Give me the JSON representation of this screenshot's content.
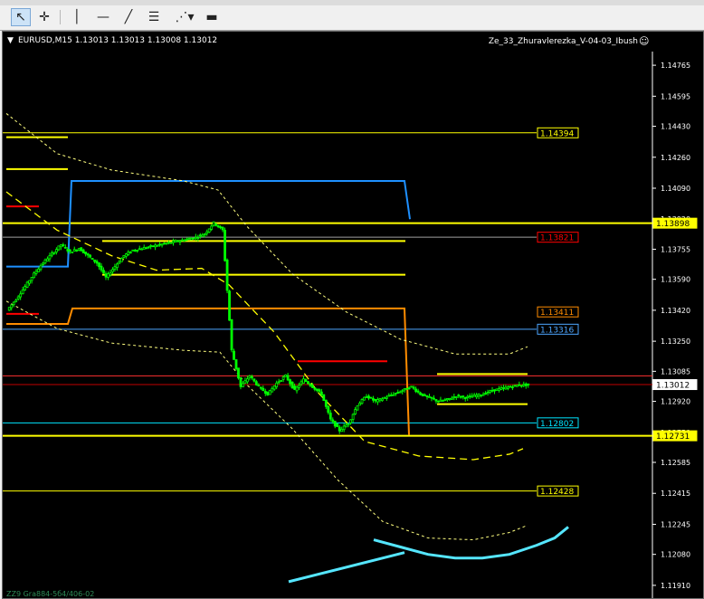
{
  "toolbar": {
    "items": [
      {
        "name": "cursor-tool-icon",
        "glyph": "↖"
      },
      {
        "name": "crosshair-tool-icon",
        "glyph": "✛"
      },
      {
        "name": "vertical-line-tool-icon",
        "glyph": "│"
      },
      {
        "name": "horizontal-line-tool-icon",
        "glyph": "—"
      },
      {
        "name": "trendline-tool-icon",
        "glyph": "╱"
      },
      {
        "name": "fibonacci-tool-icon",
        "glyph": "☰"
      },
      {
        "name": "shapes-tool-icon",
        "glyph": "⋰▾"
      },
      {
        "name": "label-tool-icon",
        "glyph": "▬"
      }
    ]
  },
  "chart": {
    "symbol_info": "EURUSD,M15  1.13013 1.13013 1.13008 1.13012",
    "indicator_name": "Ze_33_Zhuravlerezka_V-04-03_Ibush",
    "smiley_icon": "☺",
    "footer_text": "ZZ9 Gra884-5б4/406-02",
    "colors": {
      "bg": "#000000",
      "axis": "#ffffff",
      "candle": "#00ff00",
      "yellow": "#ffff00",
      "blue": "#1e90ff",
      "orange": "#ff8c00",
      "red": "#ff0000",
      "cyan": "#00e5ff"
    }
  },
  "chart_data": {
    "type": "candlestick",
    "symbol": "EURUSD",
    "timeframe": "M15",
    "ylim": [
      1.1184,
      1.1484
    ],
    "y_ticks": [
      "1.14765",
      "1.14595",
      "1.14430",
      "1.14260",
      "1.14090",
      "1.13920",
      "1.13755",
      "1.13590",
      "1.13420",
      "1.13250",
      "1.13085",
      "1.12920",
      "1.12750",
      "1.12585",
      "1.12415",
      "1.12245",
      "1.12080",
      "1.11910"
    ],
    "price_labels": [
      {
        "text": "1.14394",
        "value": 1.14394,
        "color": "#ffff00",
        "bg": "#000000"
      },
      {
        "text": "1.13898",
        "value": 1.13898,
        "color": "#000000",
        "bg": "#ffff00"
      },
      {
        "text": "1.13821",
        "value": 1.13821,
        "color": "#ff0000",
        "bg": "#000000"
      },
      {
        "text": "1.13411",
        "value": 1.13411,
        "color": "#ff8c00",
        "bg": "#000000"
      },
      {
        "text": "1.13316",
        "value": 1.13316,
        "color": "#4da6ff",
        "bg": "#000000"
      },
      {
        "text": "1.13012",
        "value": 1.13012,
        "color": "#000000",
        "bg": "#ffffff"
      },
      {
        "text": "1.12802",
        "value": 1.12802,
        "color": "#00e5ff",
        "bg": "#000000"
      },
      {
        "text": "1.12731",
        "value": 1.12731,
        "color": "#000000",
        "bg": "#ffff00"
      },
      {
        "text": "1.12428",
        "value": 1.12428,
        "color": "#ffff00",
        "bg": "#000000"
      }
    ],
    "price_path": [
      1.1342,
      1.1348,
      1.1355,
      1.1362,
      1.1368,
      1.1373,
      1.1378,
      1.1374,
      1.1376,
      1.1372,
      1.1368,
      1.136,
      1.1366,
      1.1372,
      1.1375,
      1.1376,
      1.1377,
      1.1378,
      1.1379,
      1.138,
      1.1381,
      1.1382,
      1.1384,
      1.139,
      1.1386,
      1.132,
      1.13,
      1.1306,
      1.13,
      1.1296,
      1.1302,
      1.1306,
      1.1298,
      1.1304,
      1.13,
      1.1296,
      1.1282,
      1.1276,
      1.128,
      1.129,
      1.1295,
      1.1292,
      1.1294,
      1.1296,
      1.1298,
      1.13,
      1.1296,
      1.1294,
      1.1292,
      1.1293,
      1.1295,
      1.1294,
      1.1295,
      1.1296,
      1.1298,
      1.1299,
      1.13,
      1.1301,
      1.1301
    ]
  }
}
